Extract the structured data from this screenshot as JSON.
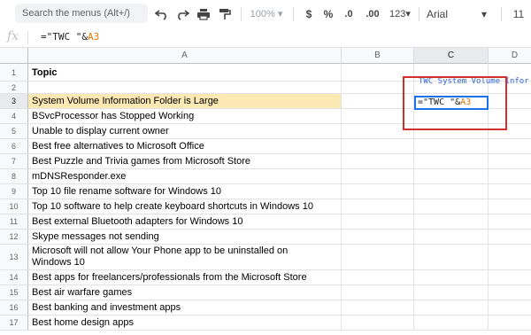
{
  "toolbar": {
    "search_placeholder": "Search the menus (Alt+/)",
    "zoom": "100%",
    "currency": "$",
    "percent": "%",
    "decrease_decimal": ".0",
    "increase_decimal": ".00",
    "more_formats": "123",
    "font": "Arial",
    "font_size": "11"
  },
  "formula_bar": {
    "fx": "fx",
    "formula_prefix": "=\"TWC \"&",
    "formula_ref": "A3"
  },
  "columns": [
    "A",
    "B",
    "C",
    "D"
  ],
  "rows": [
    {
      "num": "1",
      "text": "Topic"
    },
    {
      "num": "2",
      "text": ""
    },
    {
      "num": "3",
      "text": "System Volume Information Folder is Large"
    },
    {
      "num": "4",
      "text": "BSvcProcessor has Stopped Working"
    },
    {
      "num": "5",
      "text": "Unable to display current owner"
    },
    {
      "num": "6",
      "text": "Best free alternatives to Microsoft Office"
    },
    {
      "num": "7",
      "text": "Best Puzzle and Trivia games from Microsoft Store"
    },
    {
      "num": "8",
      "text": "mDNSResponder.exe"
    },
    {
      "num": "9",
      "text": "Top 10 file rename software for Windows 10"
    },
    {
      "num": "10",
      "text": "Top 10 software to help create keyboard shortcuts in Windows 10"
    },
    {
      "num": "11",
      "text": "Best external Bluetooth adapters for Windows 10"
    },
    {
      "num": "12",
      "text": "Skype messages not sending"
    },
    {
      "num": "13",
      "text": "Microsoft will not allow Your Phone app to be uninstalled on",
      "text2": "Windows 10"
    },
    {
      "num": "14",
      "text": "Best apps for freelancers/professionals from the Microsoft Store"
    },
    {
      "num": "15",
      "text": "Best air warfare games"
    },
    {
      "num": "16",
      "text": "Best banking and investment apps"
    },
    {
      "num": "17",
      "text": "Best home design apps"
    }
  ],
  "editor": {
    "preview": "TWC System Volume Infor",
    "prefix": "=\"TWC \"&",
    "ref": "A3"
  },
  "colors": {
    "accent": "#1a73e8",
    "highlight": "#fce8b2",
    "annotation": "#d32f2f",
    "ref": "#e37400"
  }
}
